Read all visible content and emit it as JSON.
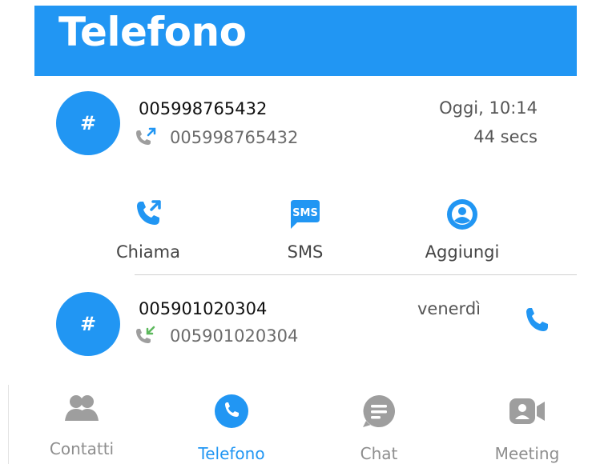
{
  "header": {
    "title": "Telefono"
  },
  "calls": [
    {
      "avatar_symbol": "#",
      "number": "005998765432",
      "sub_number": "005998765432",
      "direction_icon": "outgoing-call-icon",
      "date": "Oggi, 10:14",
      "duration": "44 secs"
    },
    {
      "avatar_symbol": "#",
      "number": "005901020304",
      "sub_number": "005901020304",
      "direction_icon": "incoming-call-icon",
      "date": "venerdì"
    }
  ],
  "actions": {
    "call_label": "Chiama",
    "sms_label": "SMS",
    "sms_icon_text": "SMS",
    "add_label": "Aggiungi"
  },
  "nav": {
    "contacts": "Contatti",
    "phone": "Telefono",
    "chat": "Chat",
    "meeting": "Meeting"
  },
  "colors": {
    "accent": "#2196f3",
    "inactive_icon": "#9e9e9e",
    "incoming_arrow": "#5cb85c"
  }
}
